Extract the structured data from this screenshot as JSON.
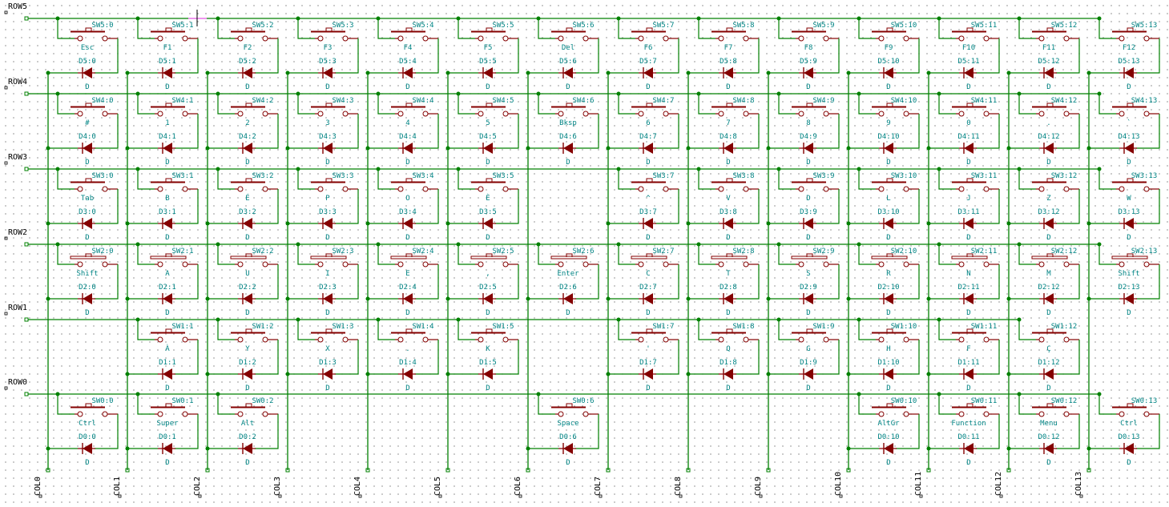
{
  "schematic": {
    "colors": {
      "wire": "#008000",
      "component": "#840000",
      "label": "#008484",
      "label_text": "#000000",
      "junction": "#008000",
      "highlight": "#ff7fff"
    },
    "rows": [
      "ROW5",
      "ROW4",
      "ROW3",
      "ROW2",
      "ROW1",
      "ROW0"
    ],
    "row_numbers": [
      5,
      4,
      3,
      2,
      1,
      0
    ],
    "columns": [
      "COL0",
      "COL1",
      "COL2",
      "COL3",
      "COL4",
      "COL5",
      "COL6",
      "COL7",
      "COL8",
      "COL9",
      "COL10",
      "COL11",
      "COL12",
      "COL13"
    ],
    "diode_value": "D",
    "keys": {
      "5": [
        "Esc",
        "F1",
        "F2",
        "F3",
        "F4",
        "F5",
        "Del",
        "F6",
        "F7",
        "F8",
        "F9",
        "F10",
        "F11",
        "F12"
      ],
      "4": [
        "#",
        "1",
        "2",
        "3",
        "4",
        "5",
        "Bksp",
        "6",
        "7",
        "8",
        "9",
        "0",
        ".",
        "`"
      ],
      "3": [
        "Tab",
        "B",
        "É",
        "P",
        "O",
        "È",
        null,
        "^",
        "V",
        "D",
        "L",
        "J",
        "Z",
        "W"
      ],
      "2": [
        "Shift",
        "A",
        "U",
        "I",
        "E",
        ",",
        "Enter",
        "C",
        "T",
        "S",
        "R",
        "N",
        "M",
        "Shift"
      ],
      "1": [
        null,
        "À",
        "Y",
        "X",
        ".",
        "K",
        null,
        "'",
        "Q",
        "G",
        "H",
        "F",
        "Ç",
        null
      ],
      "0": [
        "Ctrl",
        "Super",
        "Alt",
        null,
        null,
        null,
        "Space",
        null,
        null,
        null,
        "AltGr",
        "Function",
        "Menu",
        "Ctrl"
      ]
    }
  }
}
